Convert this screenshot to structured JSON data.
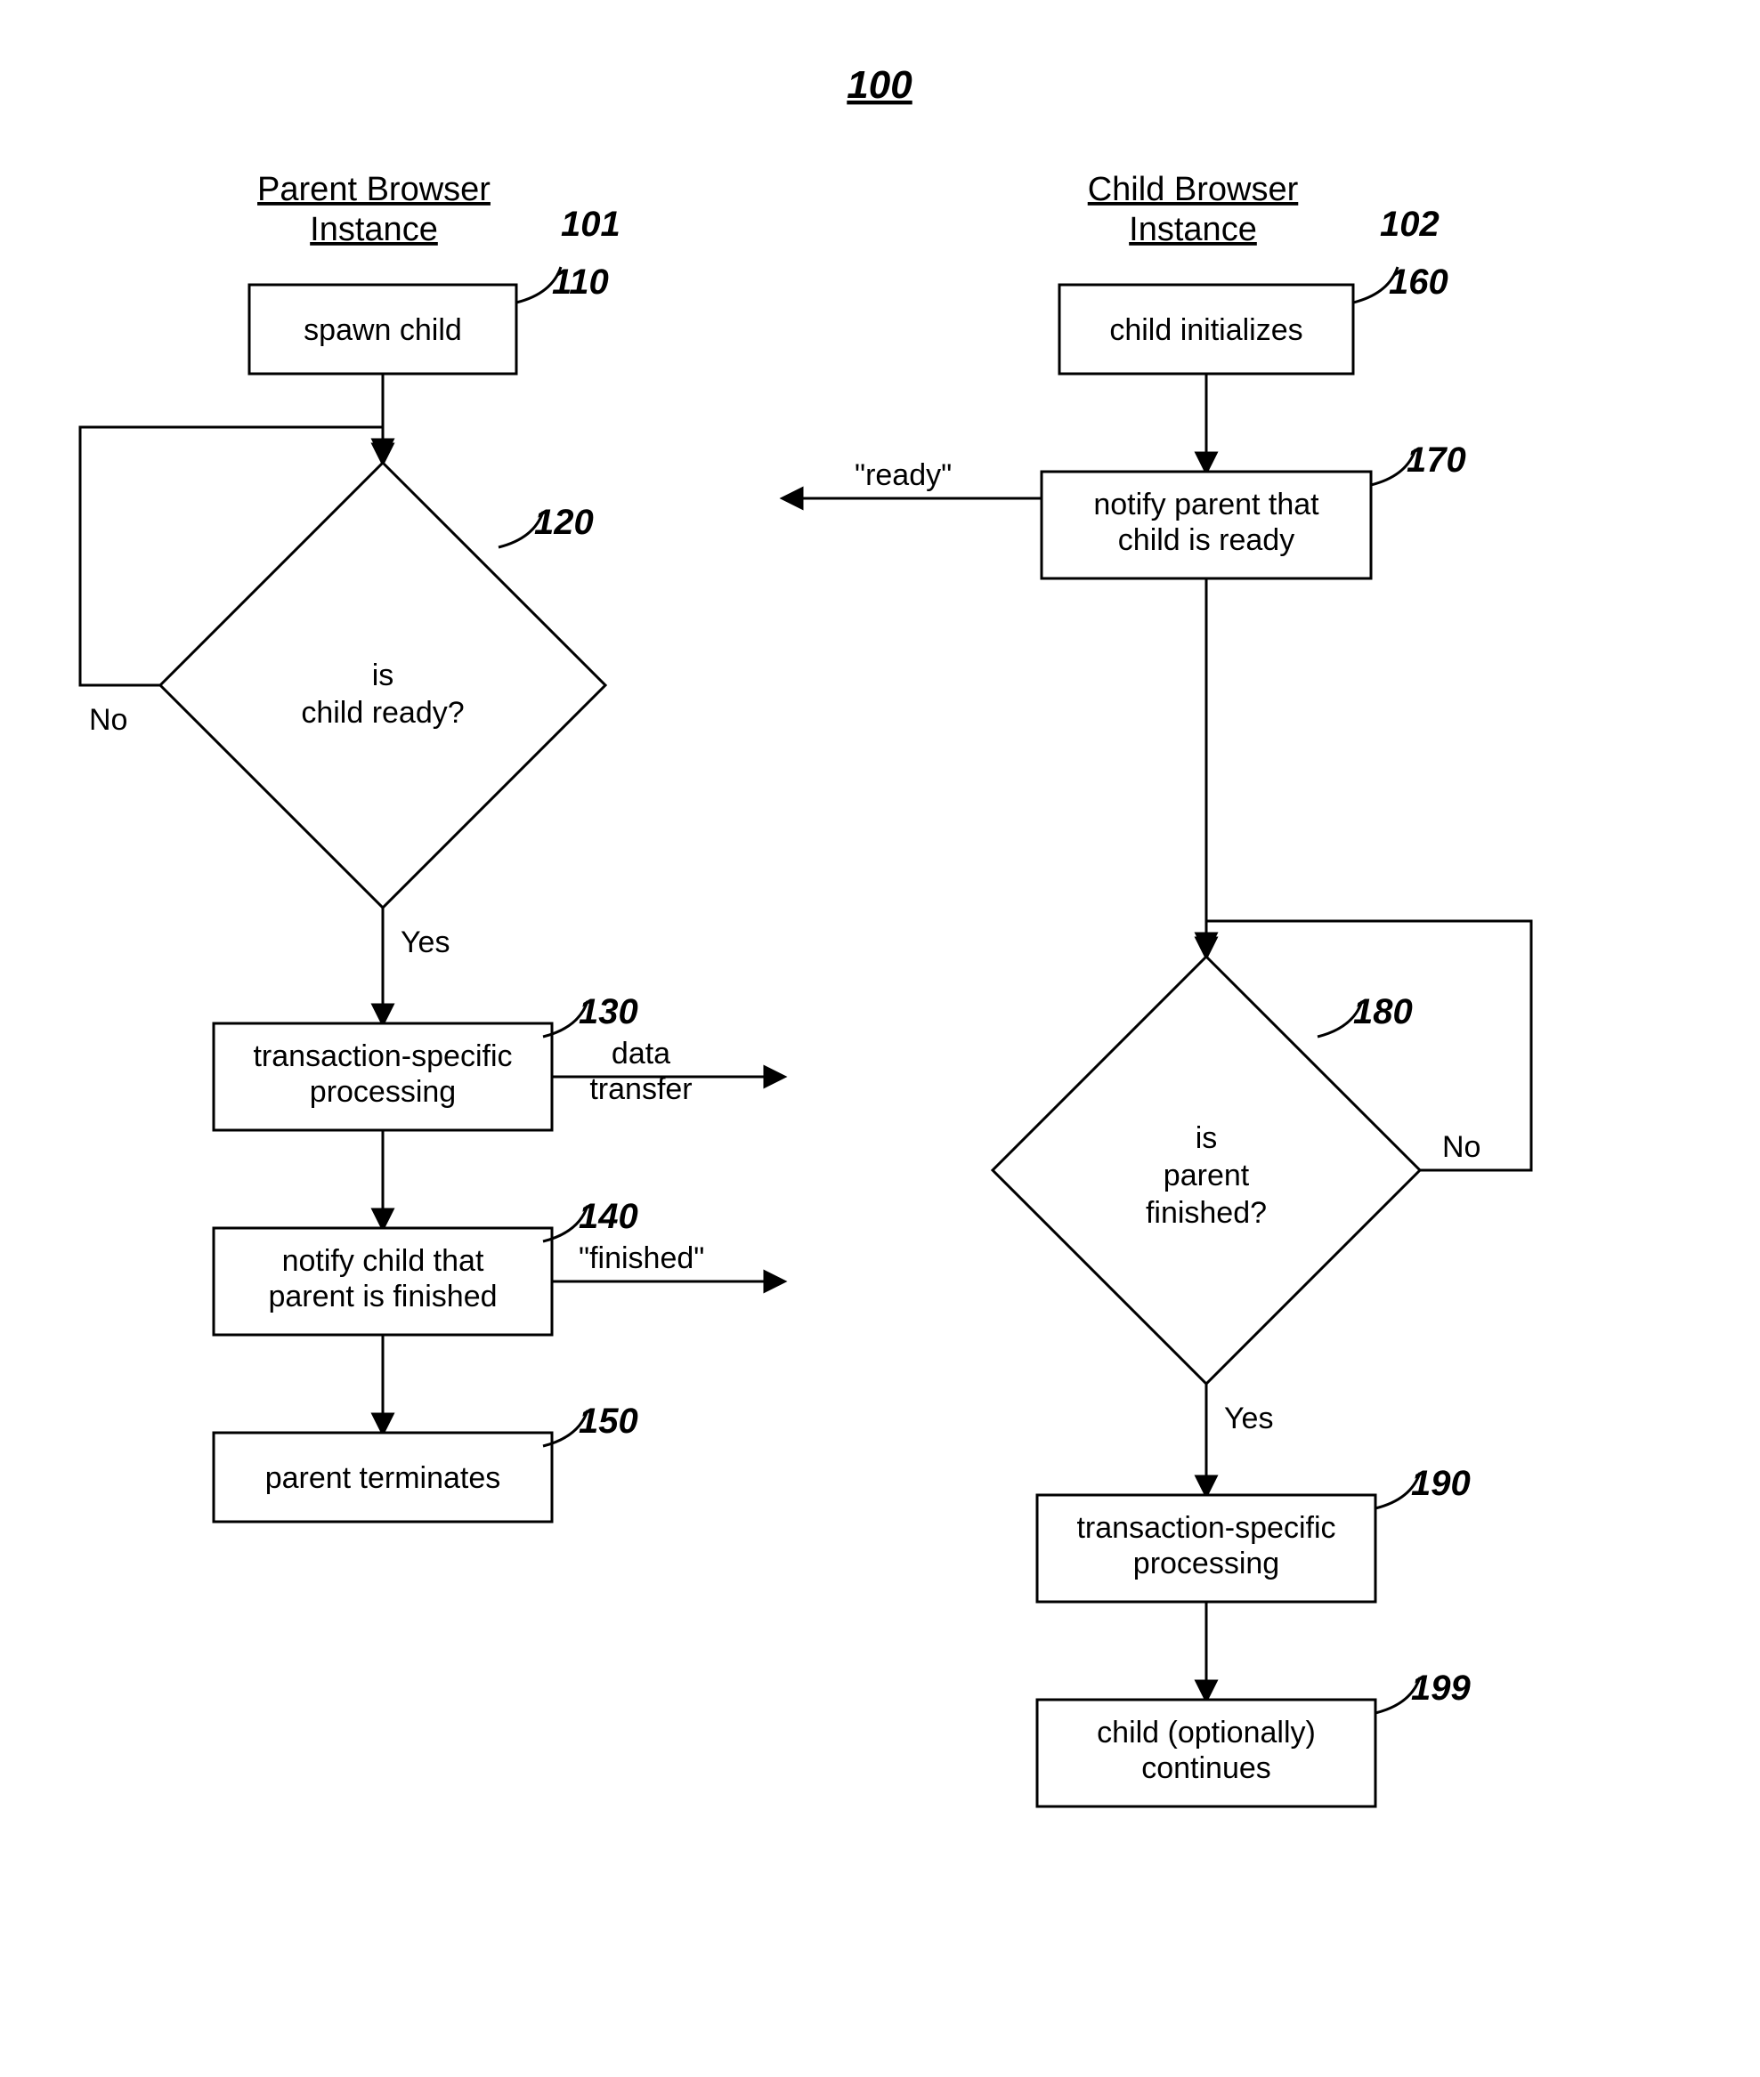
{
  "figure_ref": "100",
  "columns": {
    "parent": {
      "title_l1": "Parent Browser",
      "title_l2": "Instance",
      "ref": "101"
    },
    "child": {
      "title_l1": "Child Browser",
      "title_l2": "Instance",
      "ref": "102"
    }
  },
  "nodes": {
    "n110": {
      "ref": "110",
      "l1": "spawn child"
    },
    "n120": {
      "ref": "120",
      "l1": "is",
      "l2": "child ready?"
    },
    "n130": {
      "ref": "130",
      "l1": "transaction-specific",
      "l2": "processing"
    },
    "n140": {
      "ref": "140",
      "l1": "notify child that",
      "l2": "parent is finished"
    },
    "n150": {
      "ref": "150",
      "l1": "parent terminates"
    },
    "n160": {
      "ref": "160",
      "l1": "child initializes"
    },
    "n170": {
      "ref": "170",
      "l1": "notify parent that",
      "l2": "child is ready"
    },
    "n180": {
      "ref": "180",
      "l1": "is",
      "l2": "parent",
      "l3": "finished?"
    },
    "n190": {
      "ref": "190",
      "l1": "transaction-specific",
      "l2": "processing"
    },
    "n199": {
      "ref": "199",
      "l1": "child (optionally)",
      "l2": "continues"
    }
  },
  "edge_labels": {
    "no_left": "No",
    "yes_left": "Yes",
    "no_right": "No",
    "yes_right": "Yes",
    "ready": "\"ready\"",
    "data_l1": "data",
    "data_l2": "transfer",
    "finished": "\"finished\""
  }
}
